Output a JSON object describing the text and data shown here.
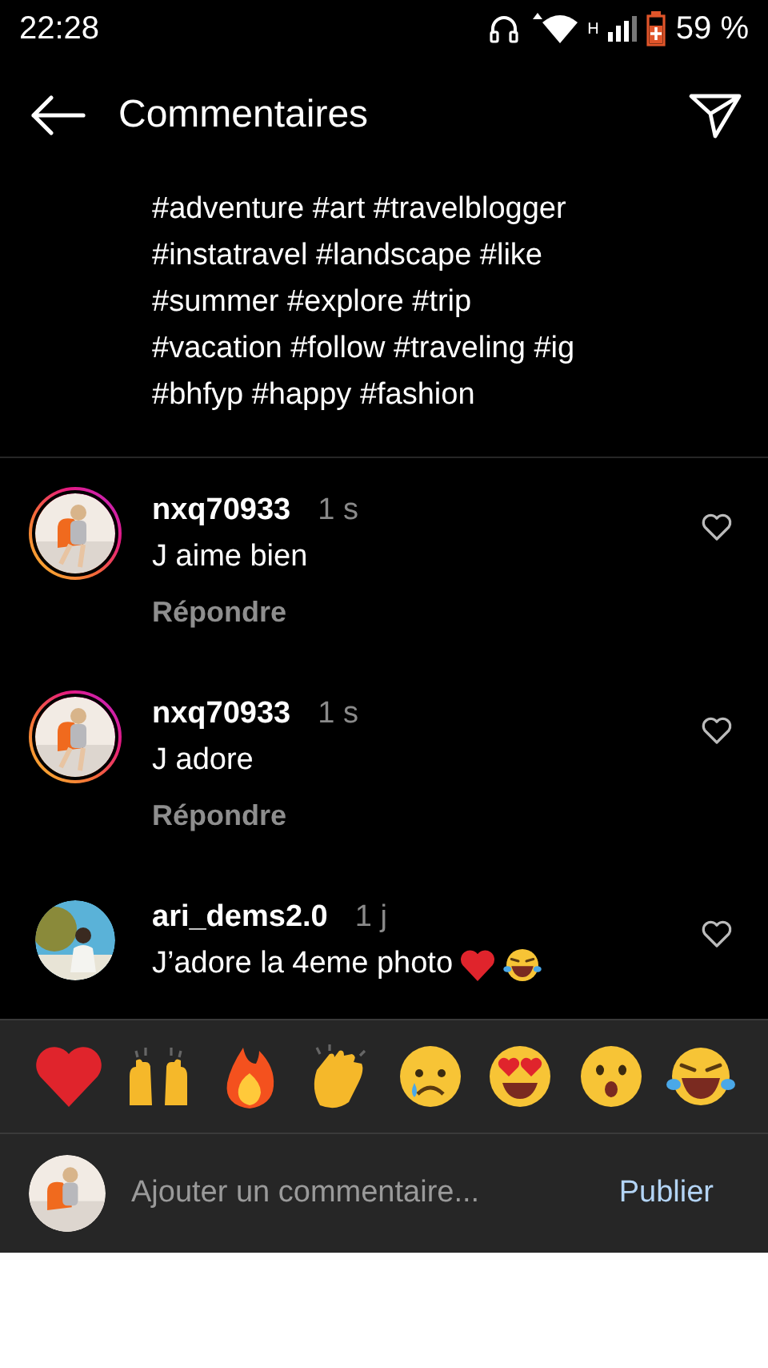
{
  "status_bar": {
    "time": "22:28",
    "network": "H",
    "battery": "59 %"
  },
  "header": {
    "title": "Commentaires"
  },
  "caption_lines": [
    "#adventure #art #travelblogger",
    "#instatravel #landscape #like",
    "#summer #explore #trip",
    "#vacation #follow #traveling #ig",
    "#bhfyp #happy #fashion"
  ],
  "comments": [
    {
      "username": "nxq70933",
      "time": "1 s",
      "text": "J aime bien",
      "reply": "Répondre",
      "story_ring": true,
      "liked": false
    },
    {
      "username": "nxq70933",
      "time": "1 s",
      "text": "J adore",
      "reply": "Répondre",
      "story_ring": true,
      "liked": false
    },
    {
      "username": "ari_dems2.0",
      "time": "1 j",
      "text": "J’adore la 4eme photo",
      "emoji": [
        {
          "kind": "heart"
        },
        {
          "kind": "tears-of-joy"
        }
      ],
      "story_ring": false,
      "liked": false
    }
  ],
  "reactions": [
    {
      "kind": "heart"
    },
    {
      "kind": "raised-hands"
    },
    {
      "kind": "fire"
    },
    {
      "kind": "clap"
    },
    {
      "kind": "crying"
    },
    {
      "kind": "heart-eyes"
    },
    {
      "kind": "surprised"
    },
    {
      "kind": "tears-of-joy"
    }
  ],
  "composer": {
    "placeholder": "Ajouter un commentaire...",
    "publish": "Publier"
  }
}
